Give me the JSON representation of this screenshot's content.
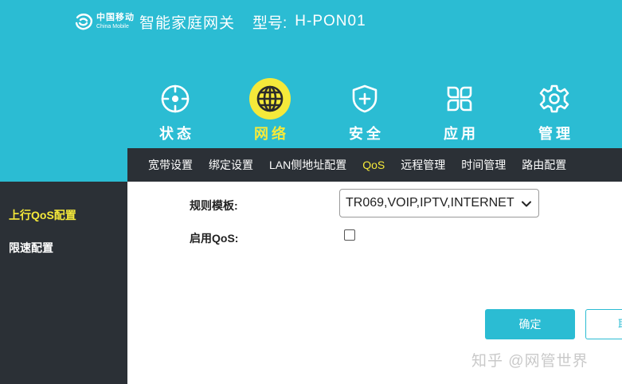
{
  "header": {
    "logo_cn": "中国移动",
    "logo_en": "China Mobile",
    "product_name": "智能家庭网关",
    "model_label": "型号:",
    "model_value": "H-PON01",
    "bg_color": "#2bbcd3",
    "accent_color": "#f5e93a"
  },
  "nav": {
    "items": [
      {
        "label": "状态",
        "icon": "status-target-icon"
      },
      {
        "label": "网络",
        "icon": "globe-icon",
        "active": true
      },
      {
        "label": "安全",
        "icon": "shield-plus-icon"
      },
      {
        "label": "应用",
        "icon": "apps-grid-icon"
      },
      {
        "label": "管理",
        "icon": "gear-icon"
      }
    ]
  },
  "subnav": {
    "items": [
      {
        "label": "宽带设置"
      },
      {
        "label": "绑定设置"
      },
      {
        "label": "LAN侧地址配置"
      },
      {
        "label": "QoS",
        "active": true
      },
      {
        "label": "远程管理"
      },
      {
        "label": "时间管理"
      },
      {
        "label": "路由配置"
      }
    ]
  },
  "sidebar": {
    "items": [
      {
        "label": "上行QoS配置",
        "active": true
      },
      {
        "label": "限速配置"
      }
    ]
  },
  "form": {
    "rule_template_label": "规则模板:",
    "rule_template_value": "TR069,VOIP,IPTV,INTERNET",
    "enable_qos_label": "启用QoS:",
    "enable_qos_checked": false
  },
  "buttons": {
    "confirm_label": "确定",
    "cancel_label_partial": "取"
  },
  "watermark": {
    "text": "知乎 @网管世界"
  }
}
